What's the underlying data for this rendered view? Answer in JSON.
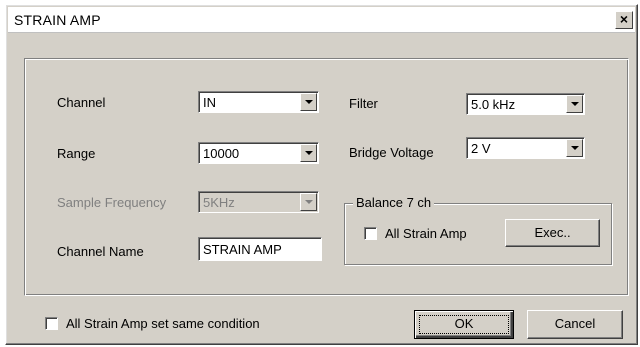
{
  "window": {
    "title": "STRAIN AMP",
    "close_glyph": "×"
  },
  "fields": {
    "channel": {
      "label": "Channel",
      "value": "IN"
    },
    "range": {
      "label": "Range",
      "value": "10000"
    },
    "sample_frequency": {
      "label": "Sample Frequency",
      "value": "5KHz"
    },
    "channel_name": {
      "label": "Channel Name",
      "value": "STRAIN AMP"
    },
    "filter": {
      "label": "Filter",
      "value": "5.0 kHz"
    },
    "bridge_voltage": {
      "label": "Bridge Voltage",
      "value": "2 V"
    }
  },
  "balance": {
    "legend": "Balance 7 ch",
    "all_strain_amp_label": "All Strain Amp",
    "all_strain_amp_checked": false,
    "exec_label": "Exec.."
  },
  "footer": {
    "same_condition_label": "All Strain Amp set same condition",
    "same_condition_checked": false,
    "ok_label": "OK",
    "cancel_label": "Cancel"
  },
  "icons": {
    "close": "close-icon",
    "dropdown": "chevron-down-icon"
  }
}
